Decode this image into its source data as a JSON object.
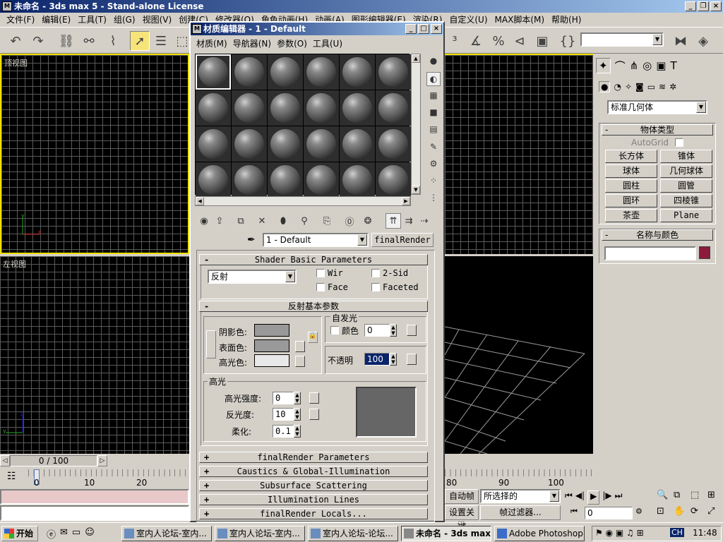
{
  "app": {
    "title": "未命名 - 3ds max 5 - Stand-alone License",
    "menu": [
      "文件(F)",
      "编辑(E)",
      "工具(T)",
      "组(G)",
      "视图(V)",
      "创建(C)",
      "修改器(O)",
      "角色动画(H)",
      "动画(A)",
      "图形编辑器(E)",
      "渲染(R)",
      "自定义(U)",
      "MAX脚本(M)",
      "帮助(H)"
    ],
    "selection_set_placeholder": ""
  },
  "viewports": {
    "top": "顶视图",
    "left": "左视图"
  },
  "timeline": {
    "frame_counter": "0 / 100",
    "ticks": [
      "0",
      "10",
      "20"
    ],
    "right_ticks": [
      "80",
      "90",
      "100"
    ]
  },
  "command_panel": {
    "category": "标准几何体",
    "object_type_title": "物体类型",
    "autogrid": "AutoGrid",
    "buttons": [
      "长方体",
      "锥体",
      "球体",
      "几何球体",
      "圆柱",
      "圆管",
      "圆环",
      "四棱锥",
      "茶壶",
      "Plane"
    ],
    "name_color_title": "名称与颜色",
    "object_color": "#8b1a3c"
  },
  "material_editor": {
    "title": "材质编辑器 - 1 - Default",
    "menu": [
      "材质(M)",
      "导航器(N)",
      "参数(O)",
      "工具(U)"
    ],
    "material_name": "1 - Default",
    "material_type": "finalRender",
    "shader_basic": {
      "title": "Shader Basic Parameters",
      "shader": "反射",
      "wire": "Wir",
      "two_sided": "2-Sid",
      "face_map": "Face",
      "faceted": "Faceted"
    },
    "reflect_basic": {
      "title": "反射基本参数",
      "ambient": "阴影色:",
      "diffuse": "表面色:",
      "specular": "高光色:",
      "self_illum": "自发光",
      "color": "颜色",
      "self_illum_value": "0",
      "opacity": "不透明",
      "opacity_value": "100"
    },
    "highlights": {
      "title": "高光",
      "spec_level": "高光强度:",
      "spec_level_value": "0",
      "glossiness": "反光度:",
      "glossiness_value": "10",
      "soften": "柔化:",
      "soften_value": "0.1"
    },
    "rollouts": [
      "finalRender  Parameters",
      "Caustics & Global-Illumination",
      "Subsurface Scattering",
      "Illumination Lines",
      "finalRender Locals..."
    ]
  },
  "anim_controls": {
    "auto_key": "自动帧",
    "set_key": "设置关键",
    "selected": "所选择的",
    "key_filters": "帧过滤器...",
    "frame": "0"
  },
  "taskbar": {
    "start": "开始",
    "tasks": [
      "室内人论坛-室内...",
      "室内人论坛-室内...",
      "室内人论坛-论坛...",
      "未命名 - 3ds max ...",
      "Adobe Photoshop"
    ],
    "ime": "CH",
    "clock": "11:48"
  }
}
